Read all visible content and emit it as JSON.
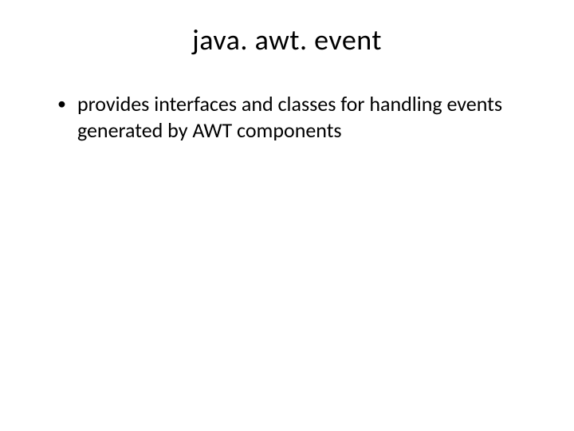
{
  "slide": {
    "title": "java. awt. event",
    "bullets": [
      {
        "text": "provides interfaces and classes for handling events generated by AWT components"
      }
    ]
  }
}
